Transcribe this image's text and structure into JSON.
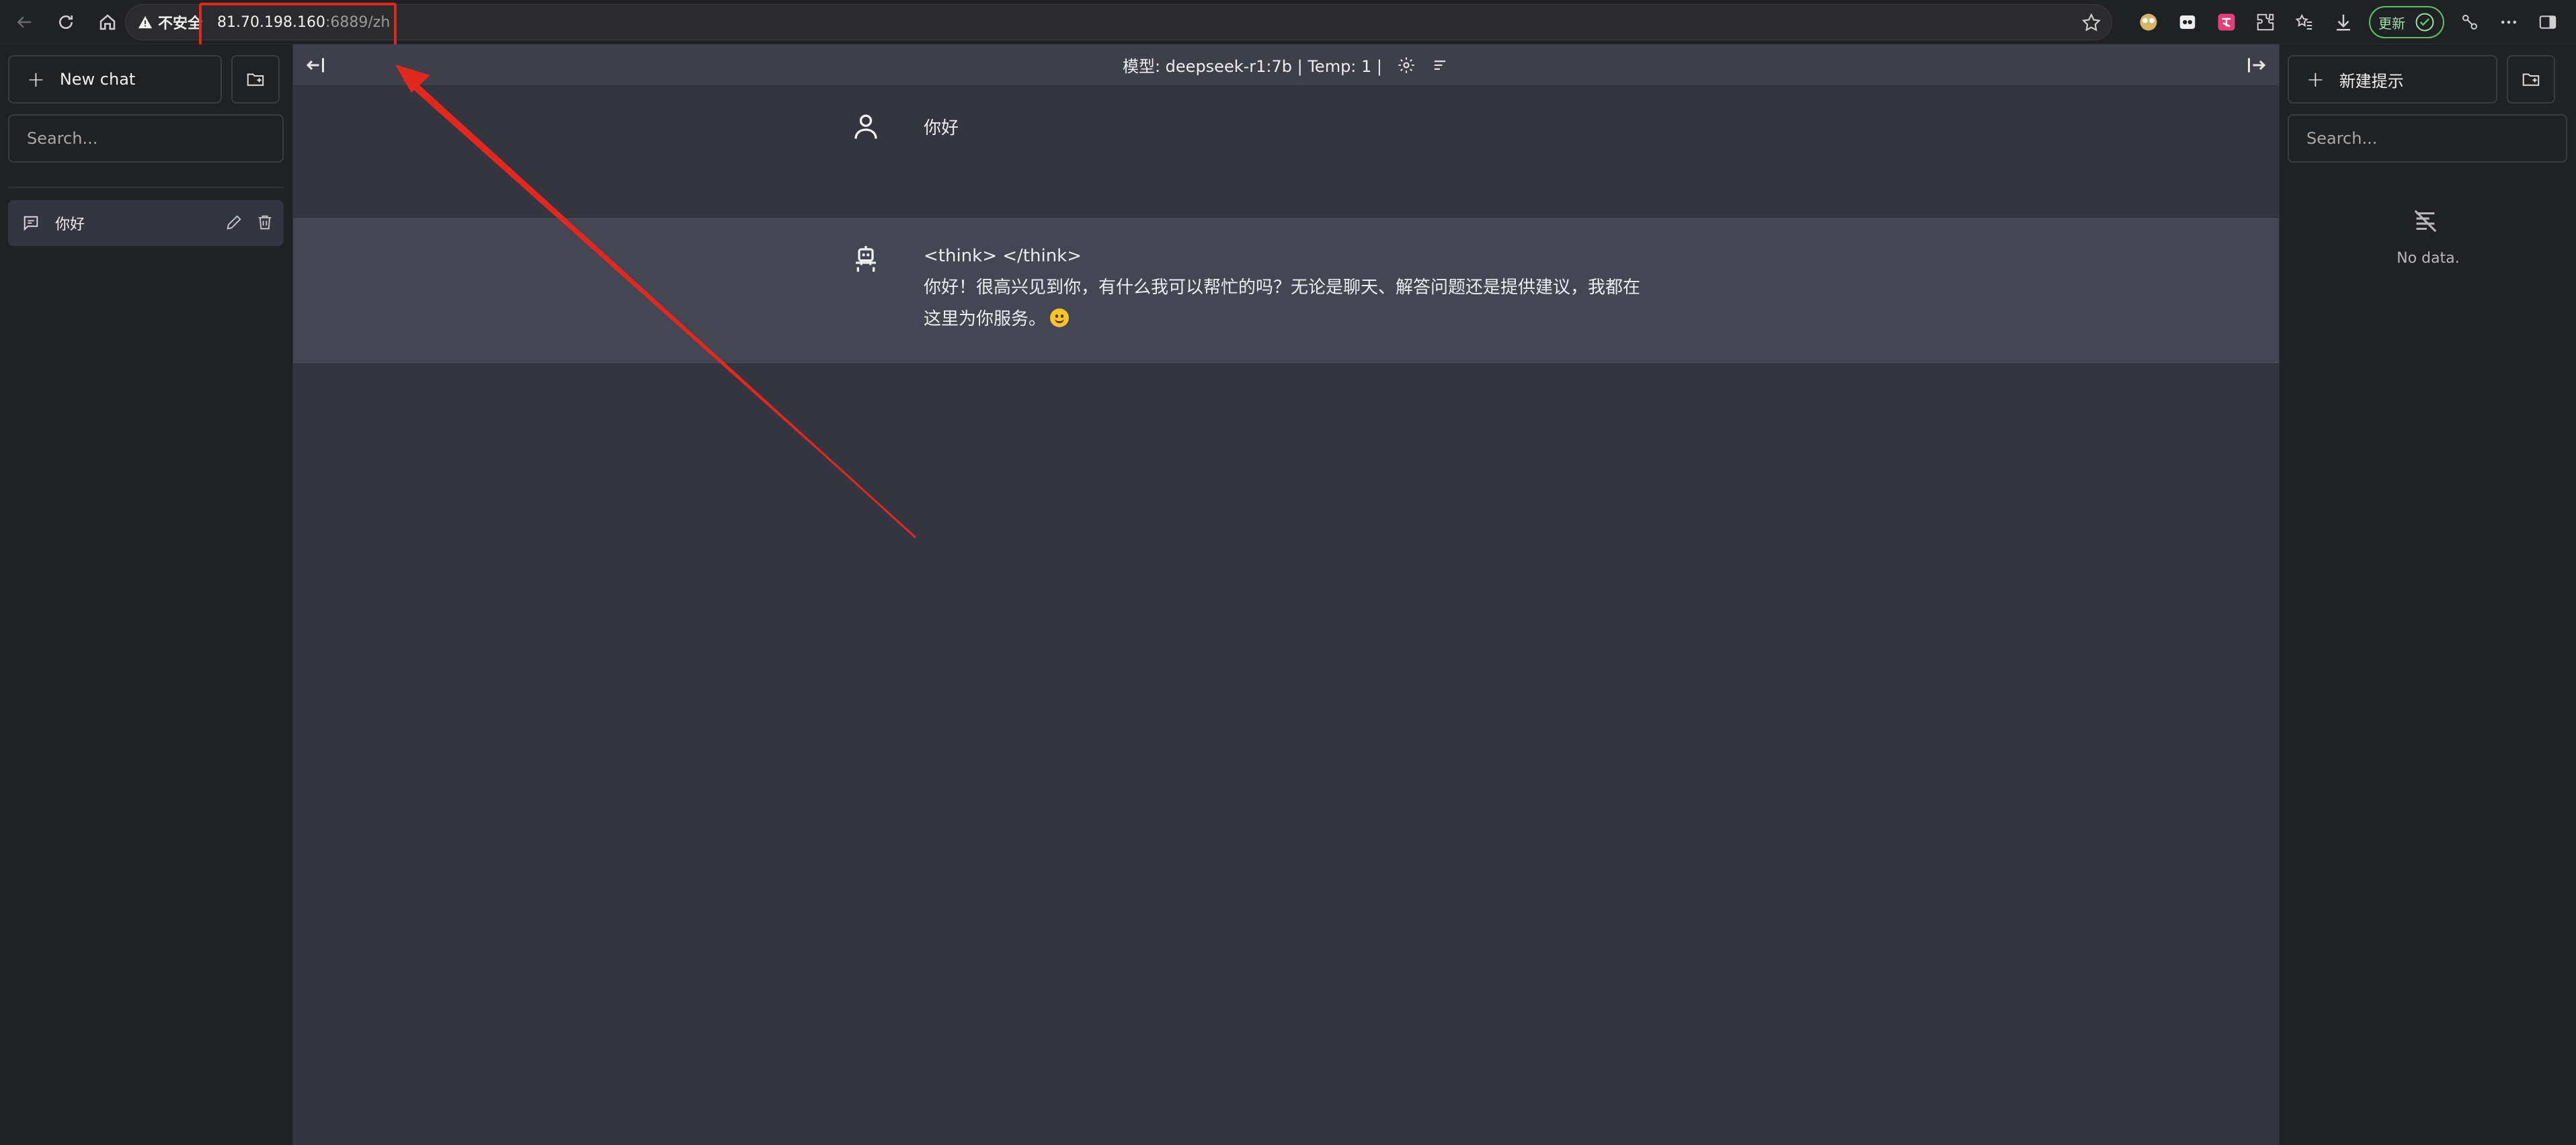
{
  "browser": {
    "security_label": "不安全",
    "url_host": "81.70.198.160",
    "url_rest": ":6889/zh",
    "update_label": "更新"
  },
  "left_sidebar": {
    "new_chat_label": "New chat",
    "search_placeholder": "Search...",
    "conversations": [
      {
        "title": "你好"
      }
    ]
  },
  "chat": {
    "header_text": "模型: deepseek-r1:7b | Temp: 1 |",
    "messages": [
      {
        "role": "user",
        "text": "你好"
      },
      {
        "role": "assistant",
        "text": "<think> </think>\n你好！很高兴见到你，有什么我可以帮忙的吗？无论是聊天、解答问题还是提供建议，我都在\n这里为你服务。"
      }
    ]
  },
  "right_sidebar": {
    "new_prompt_label": "新建提示",
    "search_placeholder": "Search...",
    "empty_text": "No data."
  },
  "colors": {
    "main_bg": "#343541",
    "assistant_bg": "#444654",
    "sidebar_bg": "#202123",
    "annotation": "#e0281e"
  }
}
